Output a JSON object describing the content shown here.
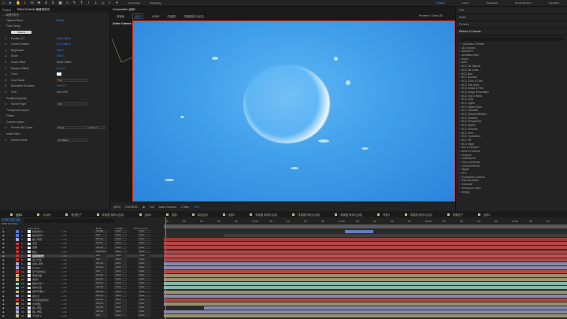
{
  "toolbar": {
    "tools": [
      "home-icon",
      "selection-icon",
      "hand-icon",
      "zoom-icon",
      "orbit-icon",
      "pan-icon",
      "dolly-icon",
      "rotate-icon",
      "camera-icon",
      "rect-icon",
      "pen-icon",
      "text-icon",
      "brush-icon",
      "clone-icon",
      "eraser-icon",
      "roto-icon",
      "puppet-icon"
    ],
    "universal": "Universal",
    "snapping": "Snapping",
    "workspaces": [
      "Default",
      "Learn",
      "Standard",
      "Small Screen",
      "Libraries"
    ]
  },
  "fx_panel": {
    "tabs": [
      "Project",
      "Effect Controls 最爱的粒光"
    ],
    "breadcrumb": "...• 最爱的粒光",
    "rows": [
      {
        "label": "Optical Flares",
        "value": "Reset",
        "type": "head"
      },
      {
        "label": "Flare Setup",
        "type": "group"
      },
      {
        "label": "Options",
        "type": "button"
      },
      {
        "label": "Position XY",
        "value": "540.0,360.0"
      },
      {
        "label": "Center Position",
        "value": "472.0,462.0"
      },
      {
        "label": "Brightness",
        "value": "100.0"
      },
      {
        "label": "Scale",
        "value": "100.0"
      },
      {
        "label": "Scale Offset",
        "value": "Scale Offset",
        "type": "check"
      },
      {
        "label": "Rotation Offset",
        "value": "0x+0.0°"
      },
      {
        "label": "Color",
        "value": "",
        "type": "color"
      },
      {
        "label": "Color Mode",
        "value": "Tint",
        "type": "select"
      },
      {
        "label": "Animation Evolution",
        "value": "0x+0.0°"
      },
      {
        "label": "GPU",
        "value": "Use GPU",
        "type": "check"
      },
      {
        "label": "Positioning Mode",
        "type": "group"
      },
      {
        "label": "Source Type",
        "value": "2D",
        "type": "select"
      },
      {
        "label": "Foreground Layers",
        "type": "group"
      },
      {
        "label": "Flicker",
        "type": "group"
      },
      {
        "label": "Custom Layers",
        "type": "group"
      },
      {
        "label": "Preview BG Layer",
        "value": "None",
        "value2": "Source",
        "type": "select"
      },
      {
        "label": "Motion Blur",
        "type": "group"
      },
      {
        "label": "Render Mode",
        "value": "On Black",
        "type": "select"
      }
    ]
  },
  "comp": {
    "tab": "Composition 运用1",
    "breadcrumbs": [
      "背景板",
      "运用1",
      "大冰块",
      "鸡金盾2",
      "雪崩图源 2(合成)"
    ],
    "active_camera": "Active Camera",
    "renderer_label": "Renderer:",
    "renderer": "Classic 3D",
    "footer": {
      "zoom": "(50%)",
      "time": "0:00:00:00",
      "quality": "Full",
      "view": "Active Camera",
      "views": "1 View",
      "exposure": "+0.0"
    }
  },
  "right_panel": {
    "sections": [
      "Info",
      "Audio",
      "Preview",
      "Effects & Presets"
    ],
    "search_placeholder": "",
    "effects": [
      "* Animation Presets",
      "3D Channel",
      "AndrewYY",
      "Animation Bym",
      "Audio",
      "BAO",
      "BCC 3D Objects",
      "BCC Art Looks",
      "BCC Blur",
      "BCC Browser",
      "BCC Color & Tone",
      "BCC Film Style",
      "BCC Grads & Tints",
      "BCC Image Restoration",
      "BCC Key & Blend",
      "BCC Lens",
      "BCC Lights",
      "BCC Match Move",
      "BCC Obsolete",
      "BCC Optical Diffusion",
      "BCC Particles",
      "BCC Perspective",
      "BCC Stylize",
      "BCC Textures",
      "BCC Time",
      "BCC Transitions",
      "BCC VR",
      "BCC Warp",
      "Blur & Sharpen",
      "Boris FX Mocha",
      "Channel",
      "CINEMA 4D",
      "Color Correction",
      "CROSSPHERE",
      "Digital",
      "EFX",
      "Expression Controls",
      "Film Emulation",
      "Generate",
      "Immersive Video",
      "Keying"
    ]
  },
  "timeline": {
    "tabs": [
      "运用1",
      "大冰块",
      "极光粒子",
      "背景图 特效2(合成)",
      "运用1",
      "雪崩",
      "辉光运动",
      "运用2",
      "背景图 特效2(合成)",
      "背景图 特效2(合成)",
      "背景图 特效2(合成)",
      "特效4",
      "背景图 特效2(合成)",
      "背景粒子",
      "运用1"
    ],
    "timecode": "0:00:00:00",
    "frames": "00000 (25.00 fps)",
    "columns": [
      "#",
      "Layer Name",
      "Mode",
      "T TrkMat",
      "Parent & Link"
    ],
    "ruler": [
      "00f",
      "05f",
      "10f",
      "15f",
      "20f",
      "01:00f",
      "05f",
      "10f",
      "15f",
      "20f",
      "02:00f",
      "05f",
      "10f",
      "15f",
      "20f",
      "03:00f",
      "05f",
      "10f",
      "15f",
      "20f",
      "04:00f",
      "05f",
      "10f"
    ],
    "layers": [
      {
        "n": "1",
        "name": "粒粒尾光 2",
        "mode": "Overlay",
        "color": "#5577cc",
        "bar": "#6a7bb8",
        "s": 0.45,
        "e": 0.52
      },
      {
        "n": "2",
        "name": "粒粒尾光 2",
        "mode": "Add",
        "color": "#5577cc",
        "bar": "#3e3e3e",
        "s": 0.15,
        "e": 1
      },
      {
        "n": "3",
        "name": "锚入雪碗",
        "mode": "Normal",
        "color": "#a8a8d8",
        "bar": "#9c3a3a",
        "s": 0,
        "e": 1
      },
      {
        "n": "4",
        "name": "光晕",
        "mode": "Screen",
        "color": "#cc3333",
        "bar": "#b04848",
        "s": 0,
        "e": 1
      },
      {
        "n": "5",
        "name": "泄漏",
        "mode": "Normal",
        "color": "#cc3333",
        "bar": "#b04848",
        "s": 0,
        "e": 1
      },
      {
        "n": "6",
        "name": "粗点",
        "mode": "Soft Light",
        "color": "#cc3333",
        "bar": "#b04848",
        "s": 0,
        "e": 1
      },
      {
        "n": "7",
        "name": "最爱的粒光",
        "mode": "Add",
        "color": "#cc3333",
        "bar": "#c05050",
        "s": 0,
        "e": 1,
        "hl": true
      },
      {
        "n": "8",
        "name": "发上光晕",
        "mode": "Add",
        "color": "#cc3333",
        "bar": "#b04848",
        "s": 0,
        "e": 1
      },
      {
        "n": "9",
        "name": "边缘+调整",
        "mode": "Normal",
        "color": "#a8a8d8",
        "bar": "#8a8aa8",
        "s": 0,
        "e": 1
      },
      {
        "n": "10",
        "name": "shadow",
        "mode": "Normal",
        "color": "#a8a8d8",
        "bar": "#8a8aa8",
        "s": 0,
        "e": 1
      },
      {
        "n": "11",
        "name": "空气发光粒子",
        "mode": "Add",
        "color": "#cc3333",
        "bar": "#b04848",
        "s": 0,
        "e": 1
      },
      {
        "n": "12",
        "name": "雾量水面",
        "mode": "Normal",
        "color": "#c9b57e",
        "bar": "#9a9070",
        "s": 0,
        "e": 1
      },
      {
        "n": "13",
        "name": "[前景]",
        "mode": "Normal",
        "color": "#c9b57e",
        "bar": "#9a9070",
        "s": 0,
        "e": 1
      },
      {
        "n": "14",
        "name": "粗金光影 2",
        "mode": "Screen",
        "color": "#9ccfc0",
        "bar": "#8ab5a8",
        "s": 0,
        "e": 1
      },
      {
        "n": "15",
        "name": "整体光晕",
        "mode": "Normal",
        "color": "#9ccfc0",
        "bar": "#8ab5a8",
        "s": 0,
        "e": 1
      },
      {
        "n": "16",
        "name": "[前景雪图] 1",
        "mode": "Normal",
        "color": "#c9b57e",
        "bar": "#9a9070",
        "s": 0,
        "e": 1
      },
      {
        "n": "17",
        "name": "简化光",
        "mode": "Normal",
        "color": "#a8a8d8",
        "bar": "#8a8aa8",
        "s": 0,
        "e": 1
      },
      {
        "n": "18",
        "name": "大水体边缘发光",
        "mode": "Normal",
        "color": "#cc3333",
        "bar": "#b04848",
        "s": 0,
        "e": 1
      },
      {
        "n": "19",
        "name": "[合成图]",
        "mode": "Normal",
        "color": "#c9b57e",
        "bar": "#9a9070",
        "s": 0,
        "e": 1
      },
      {
        "n": "20",
        "name": "锚入雪碗",
        "mode": "Normal",
        "color": "#a8a8d8",
        "bar": "#8a8aa8",
        "s": 0.1,
        "e": 1
      },
      {
        "n": "21",
        "name": "锚入雪碗",
        "mode": "Normal",
        "color": "#a8a8d8",
        "bar": "#8a8aa8",
        "s": 0,
        "e": 1
      },
      {
        "n": "22",
        "name": "大水体 2",
        "mode": "Add",
        "color": "#c9b57e",
        "bar": "#9a9070",
        "s": 0,
        "e": 1
      }
    ]
  }
}
